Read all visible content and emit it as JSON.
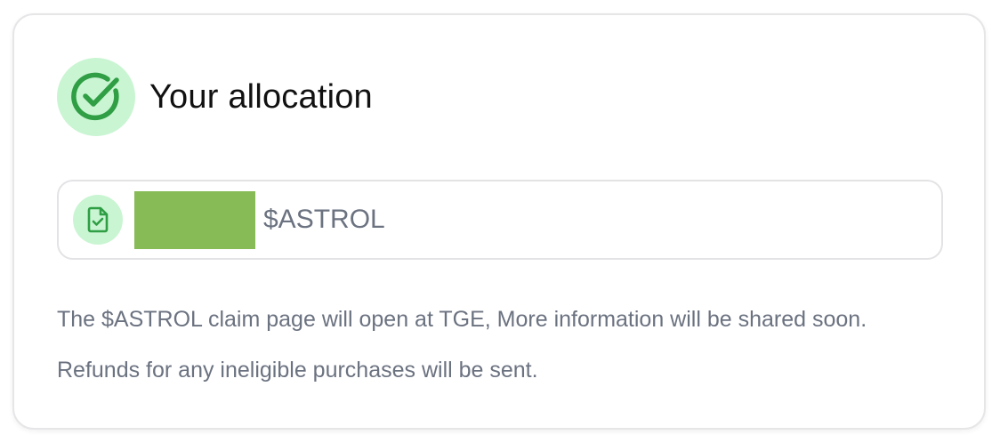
{
  "card": {
    "title": "Your allocation",
    "header_icon": "check-circle-icon"
  },
  "allocation": {
    "icon": "document-check-icon",
    "amount": "",
    "amount_redacted": true,
    "token_symbol": "$ASTROL"
  },
  "notes": {
    "line1": "The $ASTROL claim page will open at TGE, More information will be shared soon.",
    "line2": "Refunds for any ineligible purchases will be sent."
  },
  "colors": {
    "accent_green": "#2f9e44",
    "icon_bg": "#c9f5d2",
    "redaction": "#86bb55",
    "muted_text": "#6b7280"
  }
}
